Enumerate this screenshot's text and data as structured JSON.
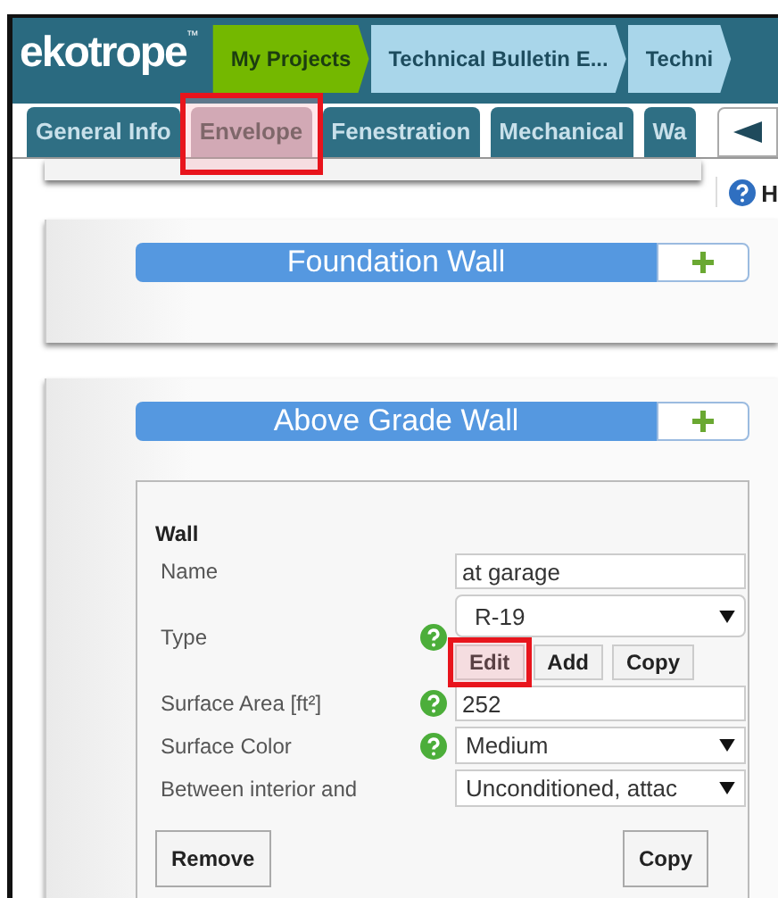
{
  "header": {
    "logo": "ekotrope",
    "logo_mark": "™",
    "breadcrumbs": [
      {
        "label": "My Projects",
        "selected": true
      },
      {
        "label": "Technical Bulletin E...",
        "selected": false
      },
      {
        "label": "Techni",
        "selected": false
      }
    ]
  },
  "tabs": [
    {
      "label": "General Info",
      "selected": false,
      "highlighted": false
    },
    {
      "label": "Envelope",
      "selected": true,
      "highlighted": true
    },
    {
      "label": "Fenestration",
      "selected": false,
      "highlighted": false
    },
    {
      "label": "Mechanical",
      "selected": false,
      "highlighted": false
    },
    {
      "label": "Wa",
      "selected": false,
      "highlighted": false
    }
  ],
  "help_link": "H",
  "sections": [
    {
      "title": "Foundation Wall"
    },
    {
      "title": "Above Grade Wall",
      "card": {
        "title": "Wall",
        "fields": [
          {
            "kind": "text",
            "label": "Name",
            "value": "at garage",
            "help": false
          },
          {
            "kind": "type",
            "label": "Type",
            "value": "R-19",
            "help": true,
            "buttons": [
              {
                "label": "Edit",
                "highlighted": true
              },
              {
                "label": "Add",
                "highlighted": false
              },
              {
                "label": "Copy",
                "highlighted": false
              }
            ]
          },
          {
            "kind": "text",
            "label": "Surface Area [ft²]",
            "value": "252",
            "help": true
          },
          {
            "kind": "select",
            "label": "Surface Color",
            "value": "Medium",
            "help": true
          },
          {
            "kind": "select",
            "label": "Between interior and",
            "value": "Unconditioned, attac",
            "help": false
          }
        ],
        "actions": [
          "Remove",
          "Copy"
        ]
      }
    }
  ]
}
